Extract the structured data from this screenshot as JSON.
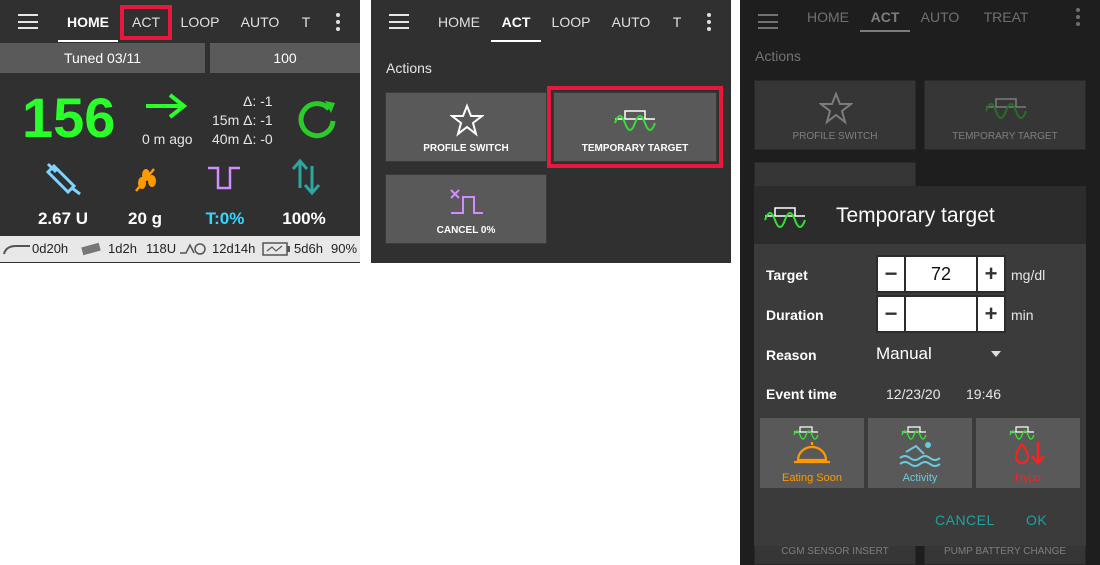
{
  "tabs_p1": [
    "HOME",
    "ACT",
    "LOOP",
    "AUTO",
    "T"
  ],
  "tabs_p2": [
    "HOME",
    "ACT",
    "LOOP",
    "AUTO",
    "T"
  ],
  "tabs_p3": [
    "HOME",
    "ACT",
    "AUTO",
    "TREAT"
  ],
  "home": {
    "profile": "Tuned 03/11",
    "target": "100",
    "bg": "156",
    "ago": "0 m ago",
    "delta": "Δ: -1",
    "delta15": "15m Δ: -1",
    "delta40": "40m Δ: -0",
    "iob": "2.67 U",
    "cob": "20 g",
    "temp": "T:0%",
    "sens": "100%",
    "status": {
      "cannula": "0d20h",
      "reservoir_age": "1d2h",
      "reservoir": "118U",
      "sensor": "12d14h",
      "battery_age": "5d6h",
      "battery": "90%"
    }
  },
  "actions": {
    "header": "Actions",
    "profile_switch": "PROFILE SWITCH",
    "temp_target": "TEMPORARY TARGET",
    "cancel": "CANCEL 0%"
  },
  "dialog": {
    "bg_header": "Actions",
    "bg_profile": "PROFILE SWITCH",
    "bg_temp": "TEMPORARY TARGET",
    "bg_cgm": "CGM SENSOR INSERT",
    "bg_battery": "PUMP BATTERY CHANGE",
    "title": "Temporary target",
    "target_label": "Target",
    "target_value": "72",
    "target_unit": "mg/dl",
    "duration_label": "Duration",
    "duration_value": "",
    "duration_unit": "min",
    "reason_label": "Reason",
    "reason_value": "Manual",
    "event_label": "Event time",
    "event_date": "12/23/20",
    "event_time": "19:46",
    "preset_eating": "Eating Soon",
    "preset_activity": "Activity",
    "preset_hypo": "Hypo",
    "cancel": "CANCEL",
    "ok": "OK"
  },
  "colors": {
    "bg_green": "#29ff29",
    "highlight": "#e8173e",
    "temp_cyan": "#33d6ff",
    "dialog_teal": "#1aa3a3",
    "eating": "#ff9900",
    "activity": "#66ccdd",
    "hypo": "#ff2020"
  }
}
